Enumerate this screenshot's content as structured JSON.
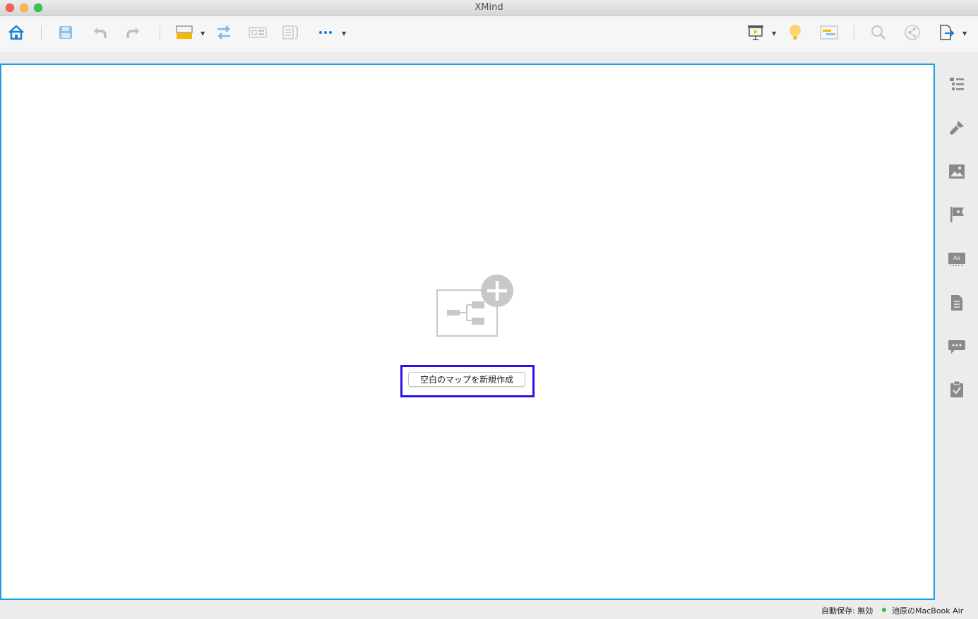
{
  "window": {
    "title": "XMind"
  },
  "toolbar": {
    "left_icons": [
      "home-icon",
      "save-icon",
      "undo-icon",
      "redo-icon",
      "topic-style-icon",
      "relationship-icon",
      "boundary-icon",
      "summary-icon",
      "more-icon"
    ],
    "right_icons": [
      "presentation-icon",
      "brainstorm-icon",
      "gantt-icon",
      "search-icon",
      "share-icon",
      "export-icon"
    ]
  },
  "sidebar": {
    "icons": [
      "outline-icon",
      "format-icon",
      "image-icon",
      "marker-icon",
      "text-style-icon",
      "notes-icon",
      "comments-icon",
      "task-icon"
    ]
  },
  "main": {
    "new_map_button": "空白のマップを新規作成"
  },
  "status": {
    "autosave": "自動保存: 無効",
    "device": "池原のMacBook Air"
  },
  "colors": {
    "accent": "#1a9fe0",
    "highlight": "#2a12e6",
    "online": "#2ebd4a"
  }
}
